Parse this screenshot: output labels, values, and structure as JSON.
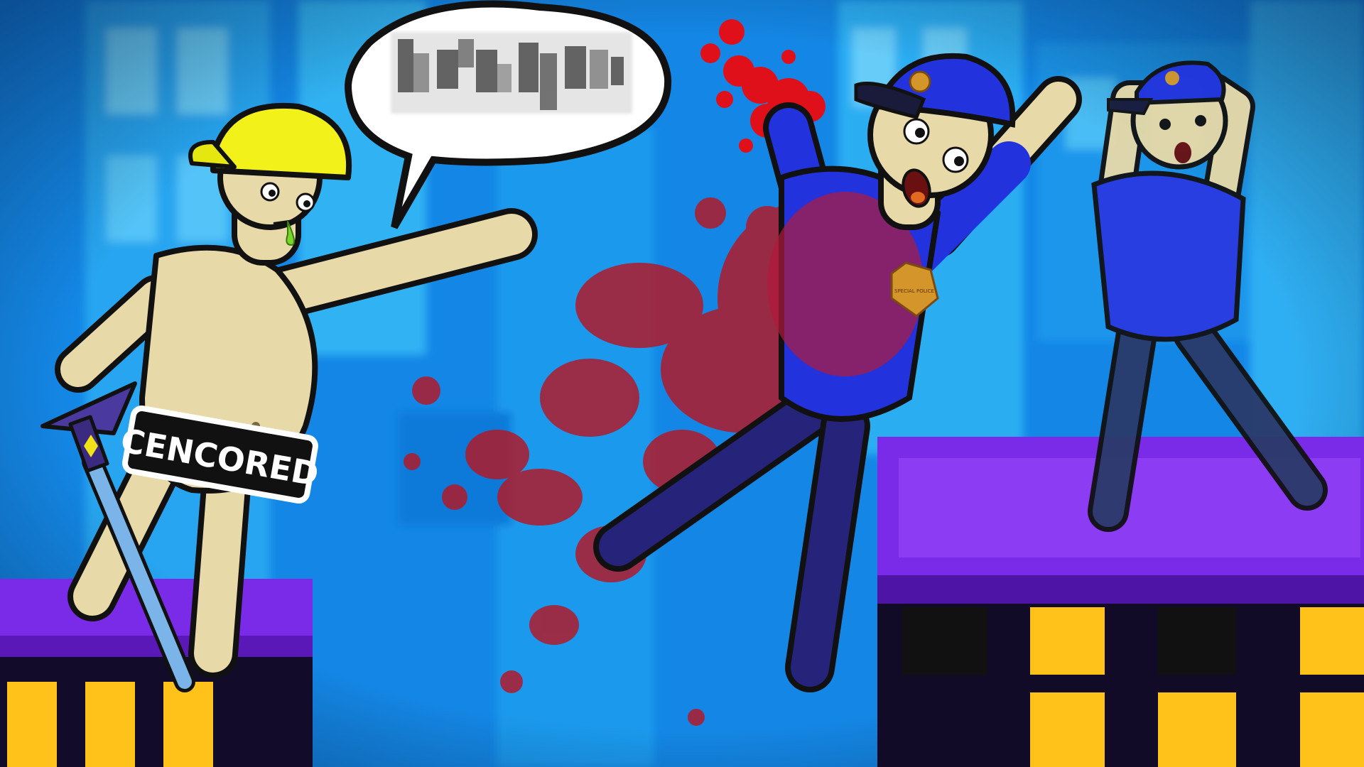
{
  "thumbnail": {
    "censor_label": "CENCORED",
    "badge_text": "SPECIAL POLICE"
  },
  "palette": {
    "sky": "#1a8fe8",
    "building_purple": "#7a2be8",
    "police_blue": "#2233dd",
    "skin": "#e8d9a8",
    "cap_yellow": "#f2f21a",
    "blood": "#c0141c",
    "window_yellow": "#ffc21a"
  },
  "icons": {
    "sword": "sword-icon",
    "speech": "speech-bubble",
    "censor": "pixelated-censor"
  }
}
